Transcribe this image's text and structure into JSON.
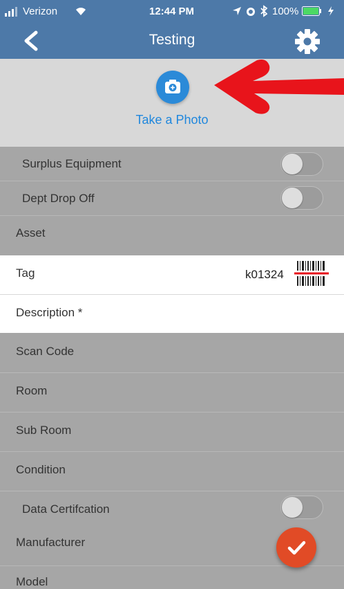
{
  "status_bar": {
    "carrier": "Verizon",
    "time": "12:44 PM",
    "battery": "100%"
  },
  "navbar": {
    "title": "Testing"
  },
  "photo": {
    "label": "Take a Photo"
  },
  "toggles": [
    {
      "label": "Surplus Equipment",
      "on": false
    },
    {
      "label": "Dept Drop Off",
      "on": false
    }
  ],
  "fields": {
    "asset": "Asset",
    "tag": {
      "label": "Tag",
      "value": "k01324"
    },
    "description": "Description *",
    "scan_code": "Scan Code",
    "room": "Room",
    "sub_room": "Sub Room",
    "condition": "Condition",
    "data_certification": {
      "label": "Data Certifcation",
      "on": false
    },
    "manufacturer": "Manufacturer",
    "model": "Model"
  },
  "colors": {
    "nav": "#4d79a8",
    "accent": "#1f87dd",
    "fab": "#e14b26",
    "arrow": "#e8141b"
  }
}
